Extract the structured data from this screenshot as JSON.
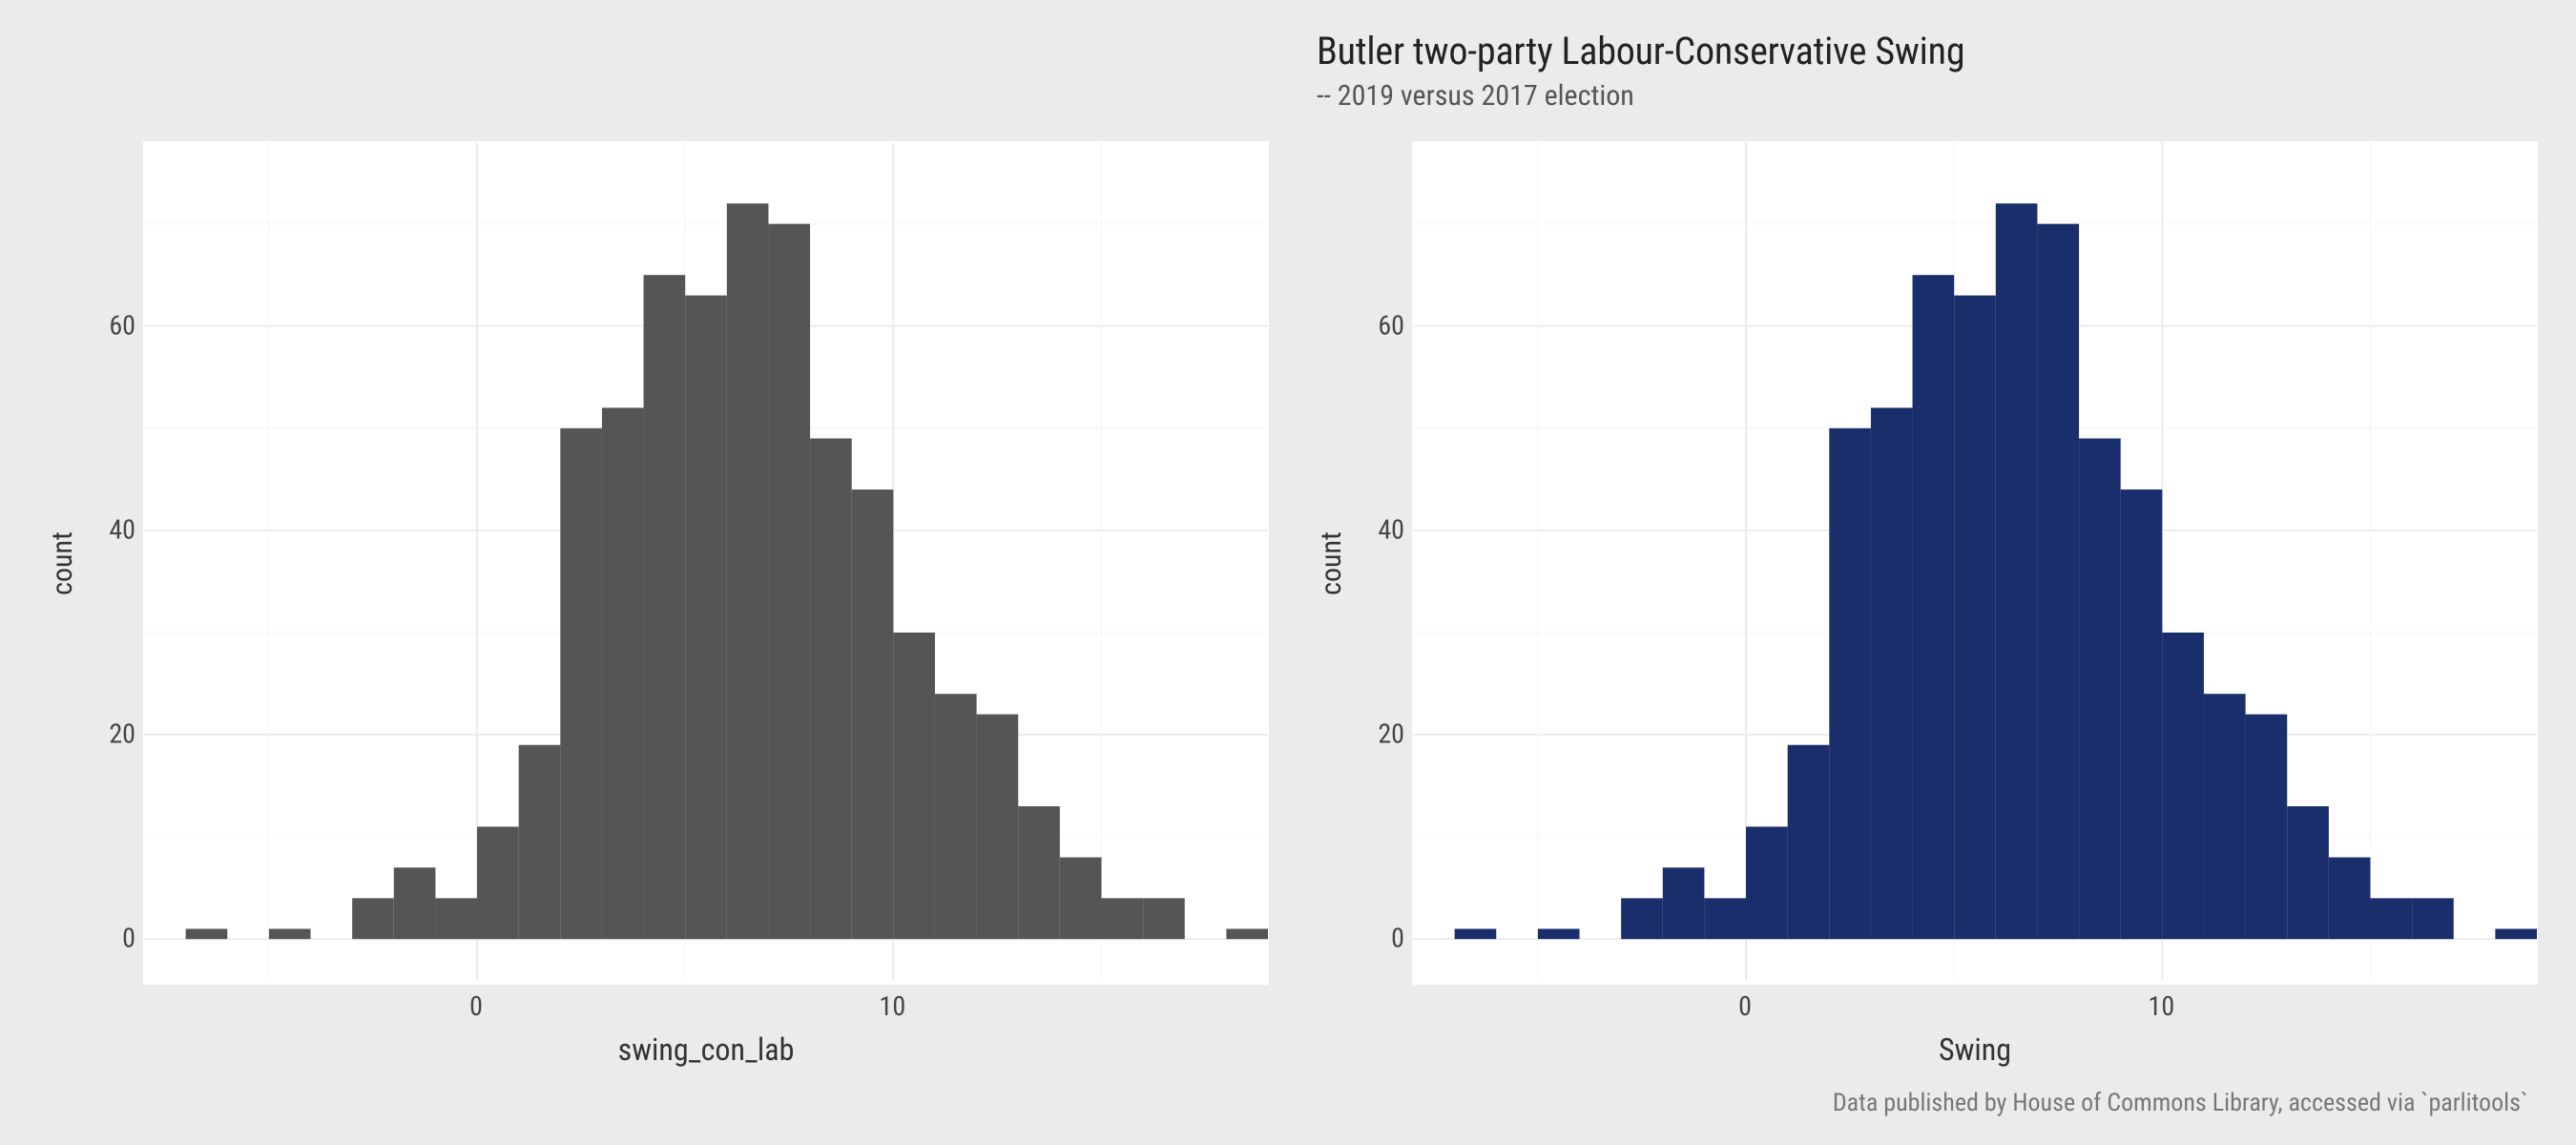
{
  "chart_data": [
    {
      "type": "bar",
      "title": "",
      "subtitle": "",
      "xlabel": "swing_con_lab",
      "ylabel": "count",
      "xlim": [
        -8,
        19
      ],
      "ylim": [
        -4,
        78
      ],
      "xticks": [
        0,
        10
      ],
      "yticks": [
        0,
        20,
        40,
        60
      ],
      "fill": "#555555",
      "bin_edges": [
        -7,
        -6,
        -5,
        -4,
        -3,
        -2,
        -1,
        0,
        1,
        2,
        3,
        4,
        5,
        6,
        7,
        8,
        9,
        10,
        11,
        12,
        13,
        14,
        15,
        16,
        17,
        18
      ],
      "counts": [
        1,
        0,
        1,
        0,
        4,
        7,
        4,
        11,
        19,
        50,
        52,
        65,
        63,
        72,
        70,
        49,
        44,
        30,
        24,
        22,
        13,
        8,
        4,
        4,
        0,
        1
      ],
      "caption": ""
    },
    {
      "type": "bar",
      "title": "Butler two-party Labour-Conservative Swing",
      "subtitle": "-- 2019 versus 2017 election",
      "xlabel": "Swing",
      "ylabel": "count",
      "xlim": [
        -8,
        19
      ],
      "ylim": [
        -4,
        78
      ],
      "xticks": [
        0,
        10
      ],
      "yticks": [
        0,
        20,
        40,
        60
      ],
      "fill": "#1a2e6b",
      "bin_edges": [
        -7,
        -6,
        -5,
        -4,
        -3,
        -2,
        -1,
        0,
        1,
        2,
        3,
        4,
        5,
        6,
        7,
        8,
        9,
        10,
        11,
        12,
        13,
        14,
        15,
        16,
        17,
        18
      ],
      "counts": [
        1,
        0,
        1,
        0,
        4,
        7,
        4,
        11,
        19,
        50,
        52,
        65,
        63,
        72,
        70,
        49,
        44,
        30,
        24,
        22,
        13,
        8,
        4,
        4,
        0,
        1
      ],
      "caption": "Data published by House of Commons Library, accessed via `parlitools`"
    }
  ]
}
